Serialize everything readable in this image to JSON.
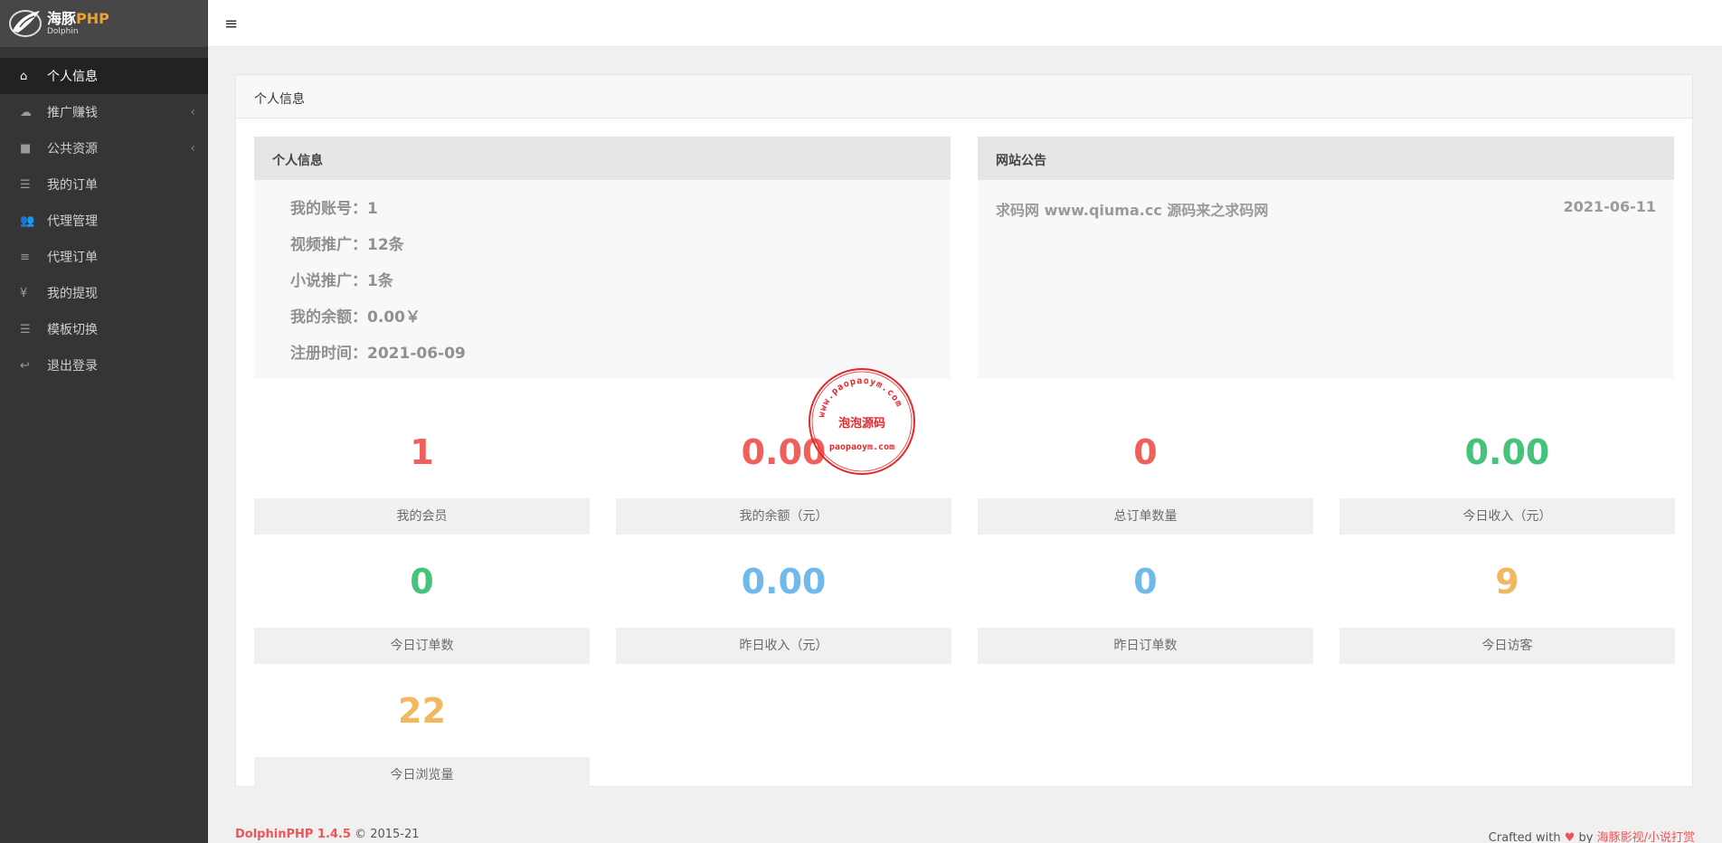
{
  "brand": {
    "name": "海豚",
    "name_php": "PHP",
    "sub": "Dolphin"
  },
  "sidebar": {
    "items": [
      {
        "label": "个人信息",
        "icon": "home-icon",
        "glyph": "⌂",
        "active": true
      },
      {
        "label": "推广赚钱",
        "icon": "cloud-icon",
        "glyph": "☁",
        "arrow": "‹"
      },
      {
        "label": "公共资源",
        "icon": "video-camera-icon",
        "glyph": "■",
        "arrow": "‹"
      },
      {
        "label": "我的订单",
        "icon": "list-icon",
        "glyph": "☰"
      },
      {
        "label": "代理管理",
        "icon": "users-icon",
        "glyph": "👥"
      },
      {
        "label": "代理订单",
        "icon": "bars-icon",
        "glyph": "≡"
      },
      {
        "label": "我的提现",
        "icon": "yen-icon",
        "glyph": "¥"
      },
      {
        "label": "模板切换",
        "icon": "list-icon",
        "glyph": "☰"
      },
      {
        "label": "退出登录",
        "icon": "reply-icon",
        "glyph": "↩"
      }
    ]
  },
  "topbar": {
    "menu_icon": "≡"
  },
  "panel": {
    "title": "个人信息"
  },
  "profile": {
    "title": "个人信息",
    "lines": [
      "我的账号：1",
      "视频推广：12条",
      "小说推广：1条",
      "我的余额：0.00￥",
      "注册时间：2021-06-09"
    ]
  },
  "notice": {
    "title": "网站公告",
    "items": [
      {
        "text": "求码网 www.qiuma.cc 源码来之求码网",
        "date": "2021-06-11"
      }
    ]
  },
  "stats": [
    {
      "value": "1",
      "label": "我的会员",
      "color": "#f0605a"
    },
    {
      "value": "0.00",
      "label": "我的余额（元）",
      "color": "#f0605a"
    },
    {
      "value": "0",
      "label": "总订单数量",
      "color": "#f0605a"
    },
    {
      "value": "0.00",
      "label": "今日收入（元）",
      "color": "#46c37b"
    },
    {
      "value": "0",
      "label": "今日订单数",
      "color": "#46c37b"
    },
    {
      "value": "0.00",
      "label": "昨日收入（元）",
      "color": "#70b9eb"
    },
    {
      "value": "0",
      "label": "昨日订单数",
      "color": "#70b9eb"
    },
    {
      "value": "9",
      "label": "今日访客",
      "color": "#f3b760"
    },
    {
      "value": "22",
      "label": "今日浏览量",
      "color": "#f3b760"
    }
  ],
  "stamp": {
    "top": "www.paopaoym.com",
    "middle": "泡泡源码",
    "bottom": "paopaoym.com"
  },
  "footer": {
    "product": "DolphinPHP 1.4.5",
    "copyright": "© 2015-21",
    "crafted": "Crafted with",
    "heart": "♥",
    "by": "by",
    "author": "海豚影视/小说打赏"
  }
}
